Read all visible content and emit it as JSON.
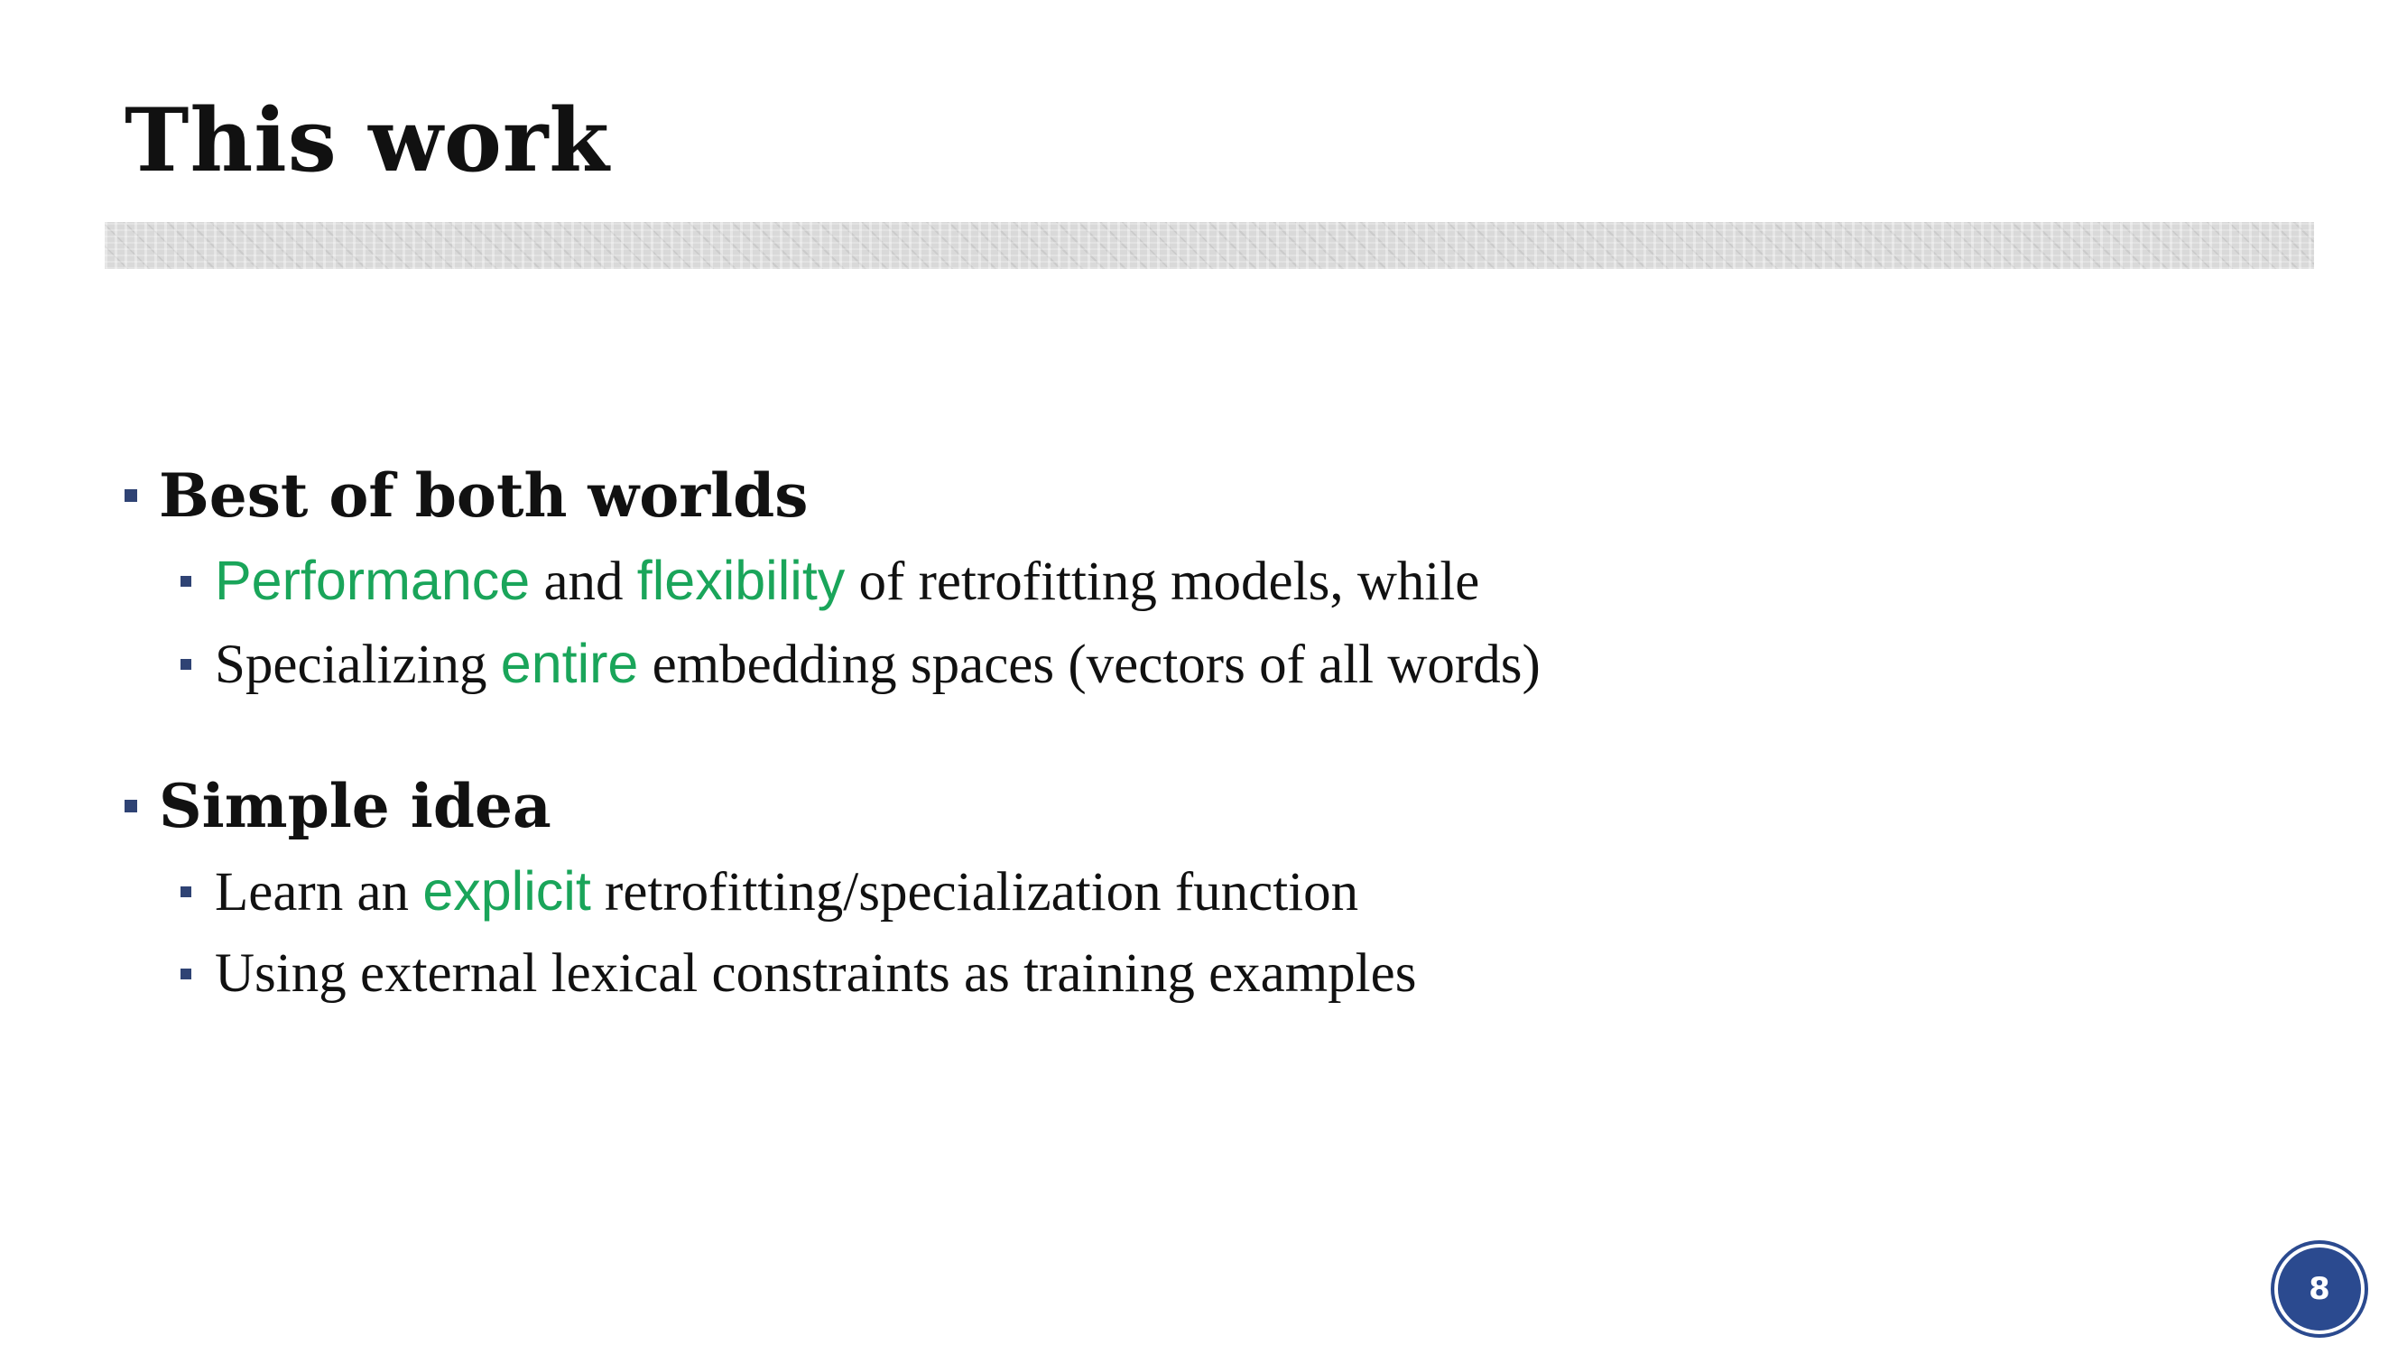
{
  "slide": {
    "title": "This work",
    "page_number": "8",
    "colors": {
      "title": "#111111",
      "highlight": "#1aa55a",
      "bullet": "#2f4374",
      "divider": "#d9d9d9",
      "page_badge": "#2b4a8f"
    },
    "sections": [
      {
        "heading": "Best of both worlds",
        "bullets": [
          {
            "parts": [
              {
                "text": "Performance",
                "highlight": true
              },
              {
                "text": " and ",
                "highlight": false
              },
              {
                "text": "flexibility",
                "highlight": true
              },
              {
                "text": " of retrofitting models, while",
                "highlight": false
              }
            ]
          },
          {
            "parts": [
              {
                "text": "Specializing ",
                "highlight": false
              },
              {
                "text": "entire",
                "highlight": true
              },
              {
                "text": " embedding spaces (vectors of all words)",
                "highlight": false
              }
            ]
          }
        ]
      },
      {
        "heading": "Simple idea",
        "bullets": [
          {
            "parts": [
              {
                "text": "Learn an ",
                "highlight": false
              },
              {
                "text": "explicit",
                "highlight": true
              },
              {
                "text": " retrofitting/specialization function",
                "highlight": false
              }
            ]
          },
          {
            "parts": [
              {
                "text": "Using external lexical constraints as training examples",
                "highlight": false
              }
            ]
          }
        ]
      }
    ]
  }
}
